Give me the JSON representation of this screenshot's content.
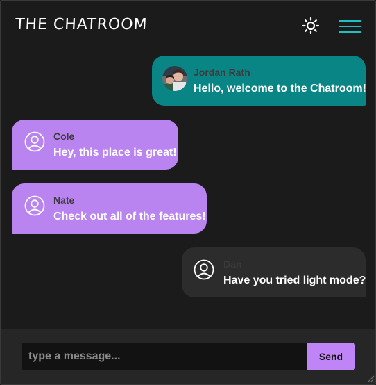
{
  "header": {
    "title": "THE CHATROOM",
    "theme_icon": "sun-icon",
    "menu_icon": "hamburger-menu-icon"
  },
  "messages": [
    {
      "name": "Jordan Rath",
      "text": "Hello, welcome to the Chatroom!",
      "avatar": "user-photo",
      "side": "right",
      "color": "#0a8585"
    },
    {
      "name": "Cole",
      "text": "Hey, this place is great!",
      "avatar": "user-circle-icon",
      "side": "left",
      "color": "#b983f0"
    },
    {
      "name": "Nate",
      "text": "Check out all of the features!",
      "avatar": "user-circle-icon",
      "side": "left",
      "color": "#b983f0"
    },
    {
      "name": "Dan",
      "text": "Have you tried light mode?",
      "avatar": "user-circle-icon",
      "side": "right",
      "color": "#2c2c2c"
    }
  ],
  "composer": {
    "placeholder": "type a message...",
    "value": "",
    "send_label": "Send"
  },
  "colors": {
    "accent_teal": "#20c0c0",
    "accent_purple": "#bf85f7",
    "background": "#1b1b1b"
  }
}
